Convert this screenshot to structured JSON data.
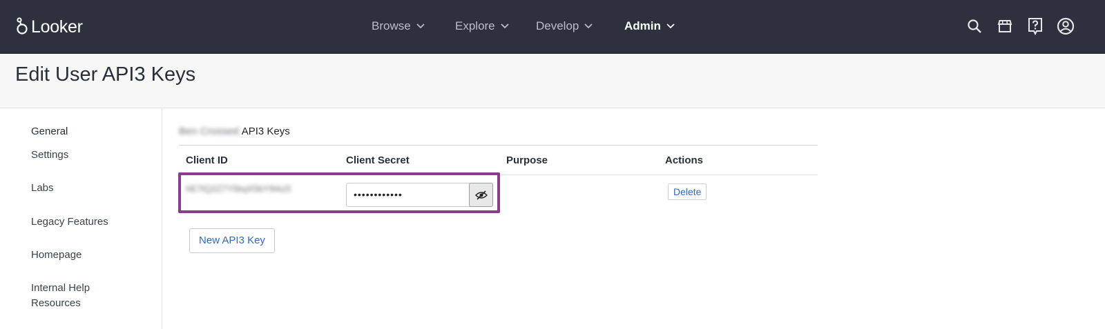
{
  "app": {
    "logo_text": "Looker"
  },
  "nav": {
    "items": [
      {
        "label": "Browse"
      },
      {
        "label": "Explore"
      },
      {
        "label": "Develop"
      },
      {
        "label": "Admin"
      }
    ]
  },
  "header": {
    "title": "Edit User API3 Keys"
  },
  "sidebar": {
    "items": [
      {
        "label": "General"
      },
      {
        "label": "Settings"
      },
      {
        "label": "Labs"
      },
      {
        "label": "Legacy Features"
      },
      {
        "label": "Homepage"
      },
      {
        "label": "Internal Help Resources"
      }
    ]
  },
  "main": {
    "section_owner": "Ben Crossed",
    "section_title": "API3 Keys",
    "table": {
      "columns": [
        "Client ID",
        "Client Secret",
        "Purpose",
        "Actions"
      ],
      "rows": [
        {
          "client_id": "hE7tQ2Z7Y5kqX5bY9rkz5",
          "client_secret": "••••••••••••",
          "purpose": "",
          "action_label": "Delete"
        }
      ]
    },
    "new_key_label": "New API3 Key"
  },
  "colors": {
    "topbar": "#2c313d",
    "highlight": "#8b3a8f",
    "link": "#2a6bc9"
  },
  "icons": [
    "search-icon",
    "marketplace-icon",
    "help-icon",
    "account-icon",
    "eye-slash-icon",
    "chevron-down-icon"
  ]
}
